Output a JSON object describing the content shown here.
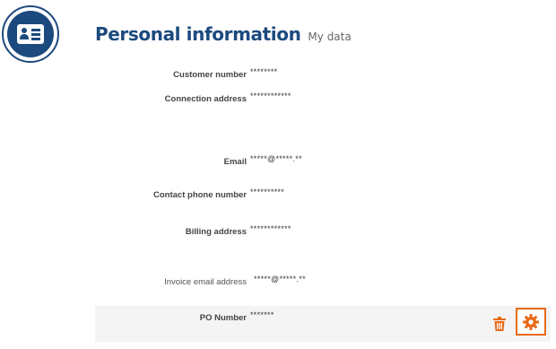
{
  "header": {
    "title": "Personal information",
    "subtitle": "My data"
  },
  "logo": {
    "icon": "id-card-icon"
  },
  "fields": {
    "customer_number": {
      "label": "Customer number",
      "value": "********"
    },
    "connection_address": {
      "label": "Connection address",
      "value": "************"
    },
    "email": {
      "label": "Email",
      "value": "*****@*****.**"
    },
    "contact_phone": {
      "label": "Contact phone number",
      "value": "**********"
    },
    "billing_address": {
      "label": "Billing address",
      "value": "************"
    },
    "invoice_email": {
      "label": "Invoice email address",
      "value": "*****@*****.**"
    },
    "po_number": {
      "label": "PO Number",
      "value": "*******"
    }
  },
  "actions": {
    "delete_icon": "trash-icon",
    "settings_icon": "gear-icon"
  },
  "colors": {
    "brand_blue": "#1c4a7e",
    "accent_orange": "#e86a17",
    "row_background": "#f4f4f4"
  }
}
